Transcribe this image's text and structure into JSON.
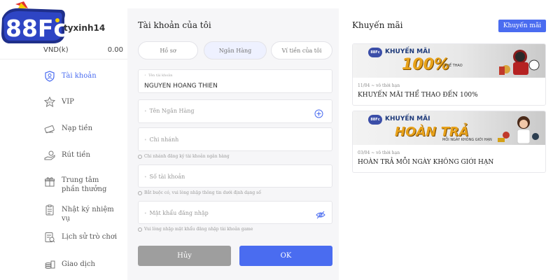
{
  "user": {
    "name": "tyxinh14",
    "currency": "VND(k)",
    "balance": "0.00"
  },
  "brand": {
    "logo_text": "88FC",
    "accent": "#4a6cf0"
  },
  "menu": [
    {
      "label": "Tài khoản",
      "icon": "user-shield-icon",
      "active": true
    },
    {
      "label": "VIP",
      "icon": "vip-badge-icon",
      "active": false
    },
    {
      "label": "Nạp tiền",
      "icon": "deposit-icon",
      "active": false
    },
    {
      "label": "Rút tiền",
      "icon": "withdraw-icon",
      "active": false
    },
    {
      "label": "Trung tâm phần thưởng",
      "icon": "gift-icon",
      "active": false
    },
    {
      "label": "Nhật ký nhiệm vụ",
      "icon": "task-log-icon",
      "active": false
    },
    {
      "label": "Lịch sử trò chơi",
      "icon": "game-history-icon",
      "active": false
    },
    {
      "label": "Giao dịch",
      "icon": "transaction-icon",
      "active": false
    }
  ],
  "account": {
    "title": "Tài khoản của tôi",
    "tabs": [
      {
        "label": "Hồ sơ",
        "active": false
      },
      {
        "label": "Ngân Hàng",
        "active": true
      },
      {
        "label": "Ví tiền của tôi",
        "active": false
      }
    ],
    "fields": {
      "holder_label": "Tên tài khoản",
      "holder_value": "NGUYEN HOANG THIEN",
      "bank_placeholder": "Tên Ngân Hàng",
      "branch_placeholder": "Chi nhánh",
      "branch_hint": "Chi nhánh đăng ký tài khoản ngân hàng",
      "number_placeholder": "Số tài khoản",
      "number_hint": "Bắt buộc có, vui lòng nhập thông tin dưới định dạng số",
      "password_placeholder": "Mật khẩu đăng nhập",
      "password_hint": "Vui lòng nhập mật khẩu đăng nhập tài khoản game"
    },
    "cancel_label": "Hủy",
    "ok_label": "OK"
  },
  "promotions": {
    "title": "Khuyến mãi",
    "button_label": "Khuyến mãi",
    "cards": [
      {
        "banner_head": "KHUYẾN MÃI",
        "banner_big": "100%",
        "banner_small": "THỂ THAO",
        "meta": "11/04 ~ vô thời hạn",
        "title": "KHUYẾN MÃI THỂ THAO ĐẾN 100%"
      },
      {
        "banner_head": "KHUYẾN MÃI",
        "banner_big": "HOÀN TRẢ",
        "banner_small": "MỖI NGÀY KHÔNG GIỚI HẠN",
        "meta": "03/04 ~ vô thời hạn",
        "title": "HOÀN TRẢ MỖI NGÀY KHÔNG GIỚI HẠN"
      }
    ]
  }
}
